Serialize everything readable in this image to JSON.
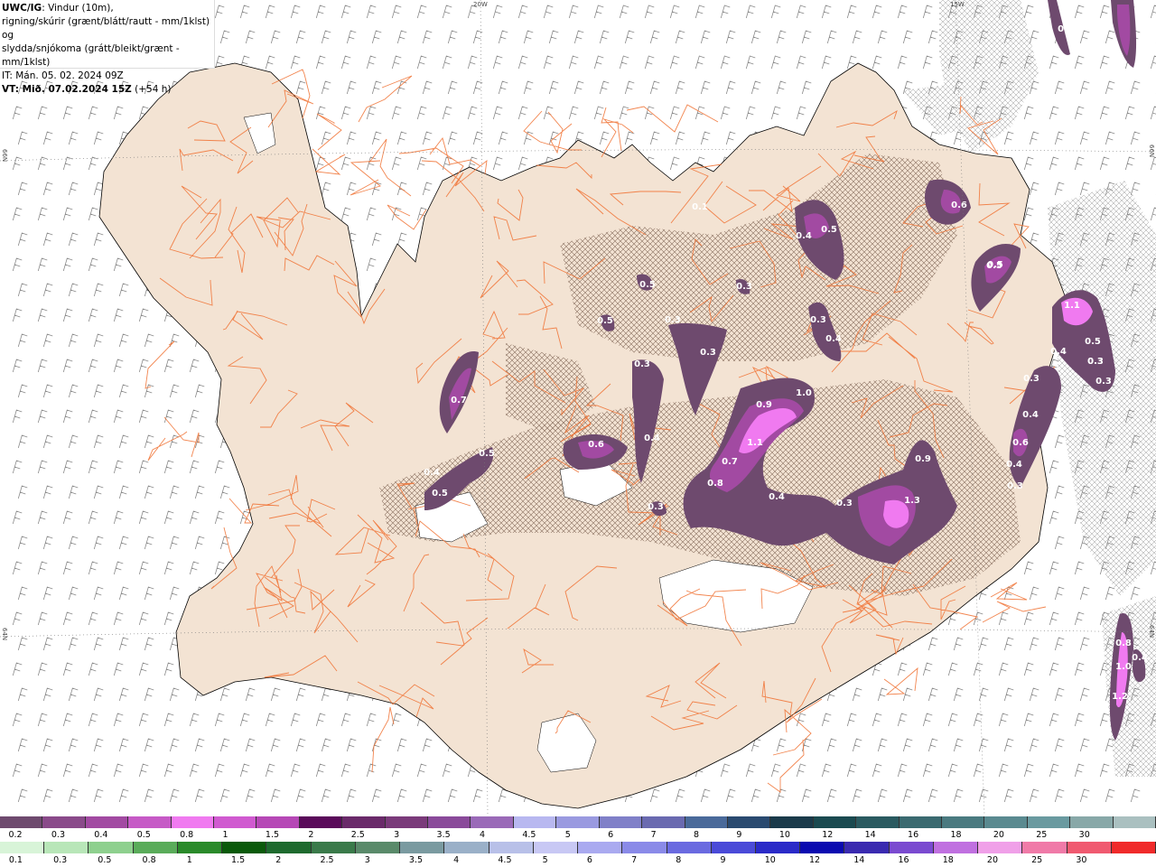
{
  "title": {
    "product": "UWC/IG",
    "desc_line1": ": Vindur (10m),",
    "desc_line2": "rigning/skúrir (grænt/blátt/rautt - mm/1klst) og",
    "desc_line3": "slydda/snjókoma (grátt/bleikt/grænt - mm/1klst)",
    "it_line": "IT: Mán. 05. 02. 2024 09Z",
    "vt_label": "VT: Mið. 07.02.2024 15Z",
    "vt_offset": " (+54 h)"
  },
  "graticule": {
    "lon_20w": "20W",
    "lon_15w": "15W",
    "lat_66n_left": "66N",
    "lat_66n_right": "66N",
    "lat_64n_left": "64N",
    "lat_64n_right": "64N"
  },
  "precip_labels": [
    "0.4",
    "0.6",
    "0.4",
    "0.5",
    "0.5",
    "0.3",
    "0.3",
    "0.4",
    "0.3",
    "0.5",
    "0.3",
    "0.5",
    "0.1",
    "0.3",
    "0.3",
    "0.3",
    "0.7",
    "1.0",
    "0.9",
    "1.1",
    "0.7",
    "0.8",
    "0.4",
    "0.6",
    "0.4",
    "0.3",
    "0.4",
    "0.5",
    "0.5",
    "0.9",
    "1.3",
    "1.1",
    "0.4",
    "0.5",
    "0.3",
    "0.3",
    "0.3",
    "0.4",
    "0.4",
    "0.6",
    "0.5",
    "0.3",
    "0.8",
    "1.0",
    "1.2",
    "0.4"
  ],
  "snow_scale": {
    "colors": [
      "#6e4a6e",
      "#8a4a8a",
      "#a24aa2",
      "#c65ac6",
      "#f07af0",
      "#d05ad0",
      "#b648b6",
      "#5a0a5a",
      "#6a2a6a",
      "#7a3a7a",
      "#8a4a9a",
      "#9a6ab8",
      "#b8b8f0",
      "#9a9ae0",
      "#8080c8",
      "#6a6ab0",
      "#4a6a9a",
      "#2a4a70",
      "#1a3a4a",
      "#1a4a50",
      "#2a5a60",
      "#3a6a70",
      "#4a7a80",
      "#5a8a90",
      "#6a9aa0",
      "#88a8a8",
      "#aac0c0"
    ],
    "labels": [
      "0.2",
      "0.3",
      "0.4",
      "0.5",
      "0.8",
      "1",
      "1.5",
      "2",
      "2.5",
      "3",
      "3.5",
      "4",
      "4.5",
      "5",
      "6",
      "7",
      "8",
      "9",
      "10",
      "12",
      "14",
      "16",
      "18",
      "20",
      "25",
      "30"
    ]
  },
  "rain_scale": {
    "colors": [
      "#d8f4d8",
      "#b8e6b8",
      "#8ed08e",
      "#5aac5a",
      "#2a8a2a",
      "#0a5a0a",
      "#1e6a2e",
      "#3a7a4a",
      "#5a8a6a",
      "#7a9aa0",
      "#9ab0c8",
      "#b8c0e8",
      "#c8c8f4",
      "#aaaaf0",
      "#8a8ae8",
      "#6a6ae0",
      "#4a4ad8",
      "#2a2ac8",
      "#0a0ab0",
      "#3a2ab0",
      "#7a4ad0",
      "#c070e0",
      "#f0a0e8",
      "#f07aa8",
      "#f05a70",
      "#f02a2a"
    ],
    "labels": [
      "0.1",
      "0.3",
      "0.5",
      "0.8",
      "1",
      "1.5",
      "2",
      "2.5",
      "3",
      "3.5",
      "4",
      "4.5",
      "5",
      "6",
      "7",
      "8",
      "9",
      "10",
      "12",
      "14",
      "16",
      "18",
      "20",
      "25",
      "30"
    ]
  }
}
